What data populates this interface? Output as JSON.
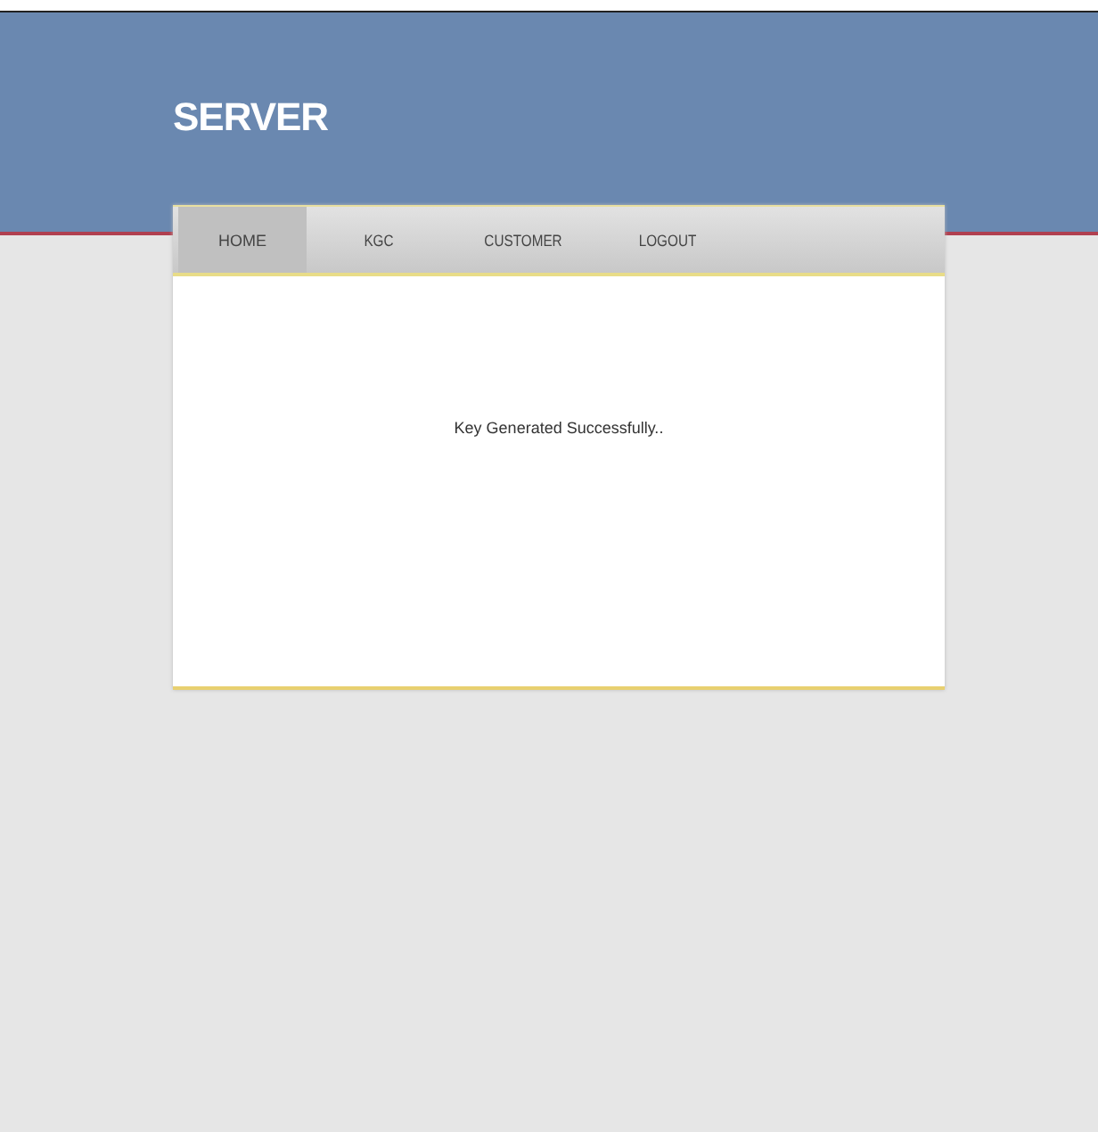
{
  "header": {
    "title": "SERVER"
  },
  "nav": [
    {
      "label": "HOME",
      "selected": true
    },
    {
      "label": "KGC",
      "selected": false
    },
    {
      "label": "CUSTOMER",
      "selected": false
    },
    {
      "label": "LOGOUT",
      "selected": false
    }
  ],
  "message": "Key Generated Successfully.."
}
